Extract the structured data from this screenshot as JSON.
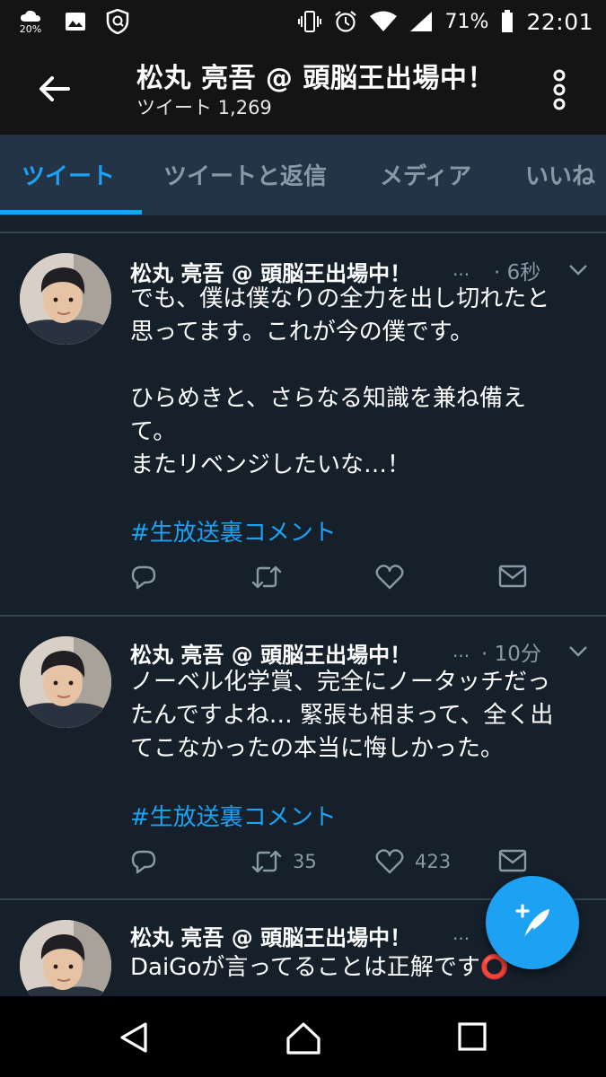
{
  "status_bar": {
    "weather_pct": "20%",
    "battery_pct": "71%",
    "clock": "22:01"
  },
  "app_bar": {
    "title": "松丸 亮吾 @ 頭脳王出場中！",
    "subtitle": "ツイート 1,269"
  },
  "tabs": [
    {
      "label": "ツイート",
      "active": true
    },
    {
      "label": "ツイートと返信",
      "active": false
    },
    {
      "label": "メディア",
      "active": false
    },
    {
      "label": "いいね",
      "active": false
    }
  ],
  "tweets": [
    {
      "name": "松丸 亮吾 @ 頭脳王出場中！",
      "ellipsis": "...",
      "time": "· 6秒",
      "lines": [
        "でも、僕は僕なりの全力を出し切れたと",
        "思ってます。これが今の僕です。",
        "",
        "ひらめきと、さらなる知識を兼ね備え",
        "て。",
        "またリベンジしたいな…！"
      ],
      "hashtag": "#生放送裏コメント",
      "retweets": "",
      "likes": ""
    },
    {
      "name": "松丸 亮吾 @ 頭脳王出場中！",
      "ellipsis": "...",
      "time": "· 10分",
      "lines": [
        "ノーベル化学賞、完全にノータッチだっ",
        "たんですよね… 緊張も相まって、全く出",
        "てこなかったの本当に悔しかった。"
      ],
      "hashtag": "#生放送裏コメント",
      "retweets": "35",
      "likes": "423"
    },
    {
      "name": "松丸 亮吾 @ 頭脳王出場中！",
      "ellipsis": "...",
      "time": "",
      "lines": [
        "DaiGoが言ってることは正解です⭕"
      ],
      "hashtag": "",
      "retweets": "",
      "likes": ""
    }
  ],
  "colors": {
    "accent": "#1da1f2",
    "background": "#15202b",
    "tab_bar": "#243447",
    "muted": "#8899a6"
  },
  "icons": [
    "weather-icon",
    "image-icon",
    "shield-icon",
    "vibrate-icon",
    "alarm-icon",
    "wifi-icon",
    "signal-icon",
    "battery-icon",
    "back-arrow-icon",
    "more-vertical-icon",
    "reply-icon",
    "retweet-icon",
    "like-icon",
    "dm-icon",
    "compose-icon",
    "nav-back-icon",
    "nav-home-icon",
    "nav-recents-icon"
  ]
}
